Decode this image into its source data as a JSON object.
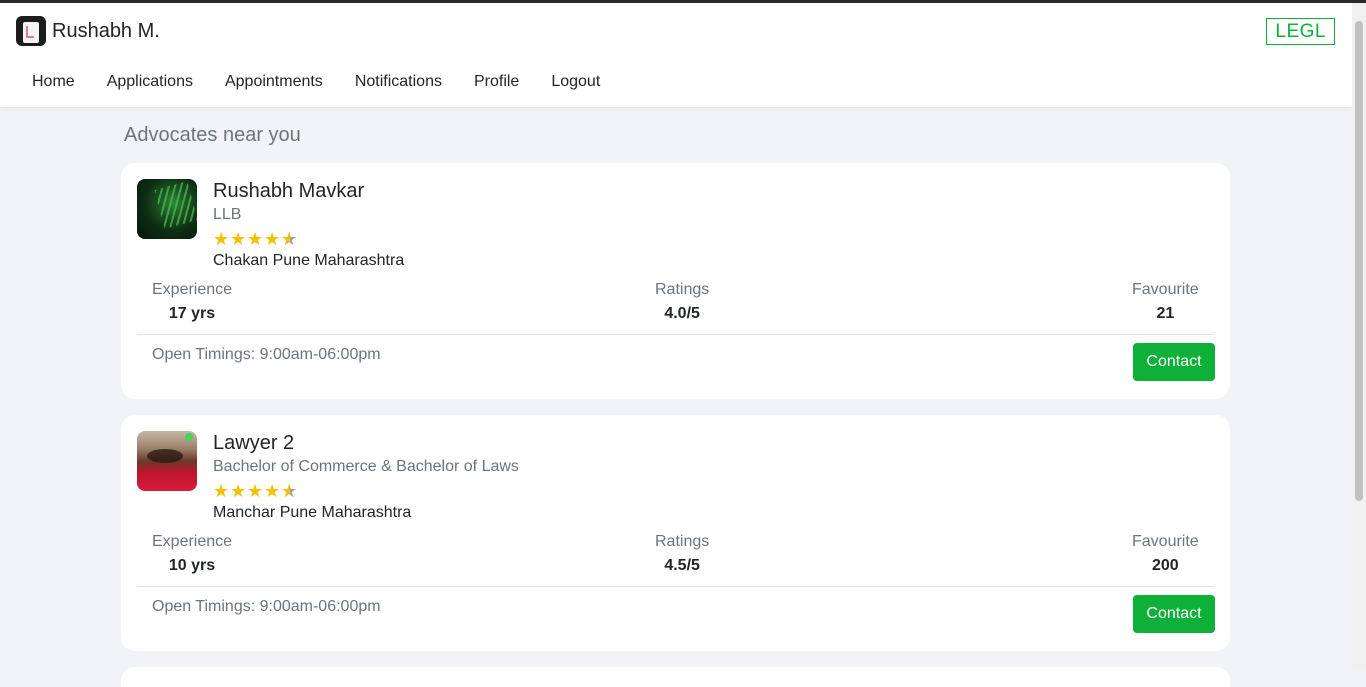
{
  "header": {
    "brand_name": "Rushabh M.",
    "logo_icon": "app-logo-icon",
    "brand_button": "LEGL",
    "nav": [
      "Home",
      "Applications",
      "Appointments",
      "Notifications",
      "Profile",
      "Logout"
    ]
  },
  "colors": {
    "accent": "#0fb03a",
    "star": "#f2c200",
    "muted": "#6c757d"
  },
  "main": {
    "section_title": "Advocates near you",
    "advocates": [
      {
        "name": "Rushabh Mavkar",
        "degree": "LLB",
        "star_rating": 4.5,
        "location": "Chakan Pune Maharashtra",
        "experience_label": "Experience",
        "experience": "17 yrs",
        "ratings_label": "Ratings",
        "ratings": "4.0/5",
        "favourite_label": "Favourite",
        "favourite": "21",
        "timings": "Open Timings: 9:00am-06:00pm",
        "contact_label": "Contact"
      },
      {
        "name": "Lawyer 2",
        "degree": "Bachelor of Commerce & Bachelor of Laws",
        "star_rating": 4.5,
        "location": "Manchar Pune Maharashtra",
        "experience_label": "Experience",
        "experience": "10 yrs",
        "ratings_label": "Ratings",
        "ratings": "4.5/5",
        "favourite_label": "Favourite",
        "favourite": "200",
        "timings": "Open Timings: 9:00am-06:00pm",
        "contact_label": "Contact"
      }
    ]
  }
}
